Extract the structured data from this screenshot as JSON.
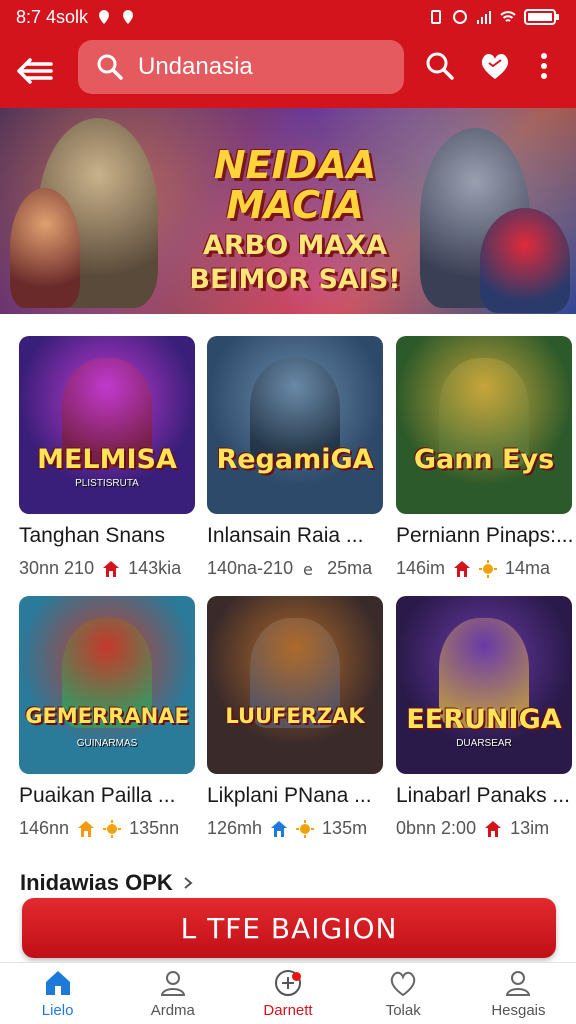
{
  "status": {
    "time": "8:7 4solk",
    "colors": {
      "bar": "#d3141c"
    }
  },
  "header": {
    "search_text": "Undanasia",
    "icons": [
      "back-arrow-icon",
      "search-icon",
      "heart-icon",
      "more-vert-icon"
    ]
  },
  "banner": {
    "title": "NEIDAA MACIA",
    "subtitle_1": "ARBO MAXA",
    "subtitle_2": "BEIMOR SAIS!"
  },
  "games": [
    {
      "logo": "MELMISA",
      "logo_sub": "PLISTISRUTA",
      "title": "Tanghan Snans",
      "meta_left": "30nn 210",
      "meta_right": "143kia",
      "badge1": "house",
      "badge2": "house",
      "colors": [
        "#3a1f7a",
        "#c23ad0",
        "#7a1e3a"
      ]
    },
    {
      "logo": "RegamiGA",
      "logo_sub": "",
      "title": "Inlansain Raia ...",
      "meta_left": "140na-210",
      "meta_right": "25ma",
      "badge1": "e",
      "badge2": "e",
      "colors": [
        "#2e4a6a",
        "#6a8aa8",
        "#1f2f3f"
      ]
    },
    {
      "logo": "Gann Eys",
      "logo_sub": "",
      "title": "Perniann Pinaps:...",
      "meta_left": "146im",
      "meta_right": "14ma",
      "badge1": "house",
      "badge2": "sun",
      "colors": [
        "#2d5a2a",
        "#c9a63a",
        "#5d7a3a"
      ]
    },
    {
      "logo": "GEMERRANAE",
      "logo_sub": "GUINARMAS",
      "title": "Puaikan Pailla ...",
      "meta_left": "146nn",
      "meta_right": "135nn",
      "badge1": "house-orange",
      "badge2": "sun",
      "colors": [
        "#2a7a9a",
        "#c8382a",
        "#3a9a5a"
      ]
    },
    {
      "logo": "LUUFERZAK",
      "logo_sub": "",
      "title": "Likplani PNana ...",
      "meta_left": "126mh",
      "meta_right": "135m",
      "badge1": "house-blue",
      "badge2": "sun",
      "colors": [
        "#3a2a2a",
        "#b06a2a",
        "#5a5a6a"
      ]
    },
    {
      "logo": "EERUNIGA",
      "logo_sub": "DUARSEAR",
      "title": "Linabarl Panaks ...",
      "meta_left": "0bnn 2:00",
      "meta_right": "13im",
      "badge1": "house",
      "badge2": "house",
      "colors": [
        "#2a1a4a",
        "#6a3aa8",
        "#c8a04a"
      ]
    }
  ],
  "section": {
    "title": "Inidawias OPK"
  },
  "cta": {
    "label": "L TFE BAIGION"
  },
  "nav": [
    {
      "label": "Lielo",
      "icon": "home-icon",
      "state": "active"
    },
    {
      "label": "Ardma",
      "icon": "user-icon",
      "state": ""
    },
    {
      "label": "Darnett",
      "icon": "plus-circle-icon",
      "state": "special"
    },
    {
      "label": "Tolak",
      "icon": "heart-outline-icon",
      "state": ""
    },
    {
      "label": "Hesgais",
      "icon": "user-icon",
      "state": ""
    }
  ]
}
